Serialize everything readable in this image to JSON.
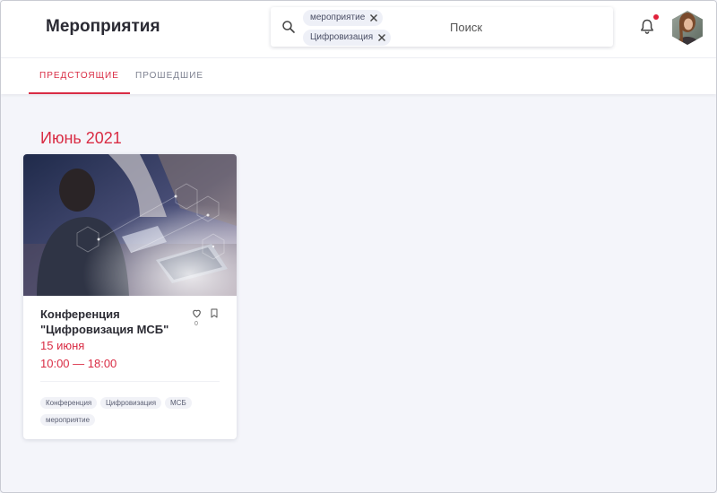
{
  "header": {
    "title": "Мероприятия",
    "search": {
      "chips": [
        "мероприятие",
        "Цифровизация"
      ],
      "placeholder": "Поиск",
      "icon": "search-icon"
    },
    "notification_icon": "bell-icon",
    "notification_dot_color": "#e0203a"
  },
  "tabs": [
    {
      "label": "ПРЕДСТОЯЩИЕ",
      "active": true
    },
    {
      "label": "ПРОШЕДШИЕ",
      "active": false
    }
  ],
  "month_heading": "Июнь 2021",
  "event_card": {
    "title_line1": "Конференция",
    "title_line2": "\"Цифровизация МСБ\"",
    "date": "15 июня",
    "time": "10:00 — 18:00",
    "likes": "0",
    "tags": [
      "Конференция",
      "Цифровизация",
      "МСБ",
      "мероприятие"
    ]
  },
  "colors": {
    "accent": "#d92c44",
    "background": "#f4f5fa",
    "chip_background": "#eef0f7"
  }
}
